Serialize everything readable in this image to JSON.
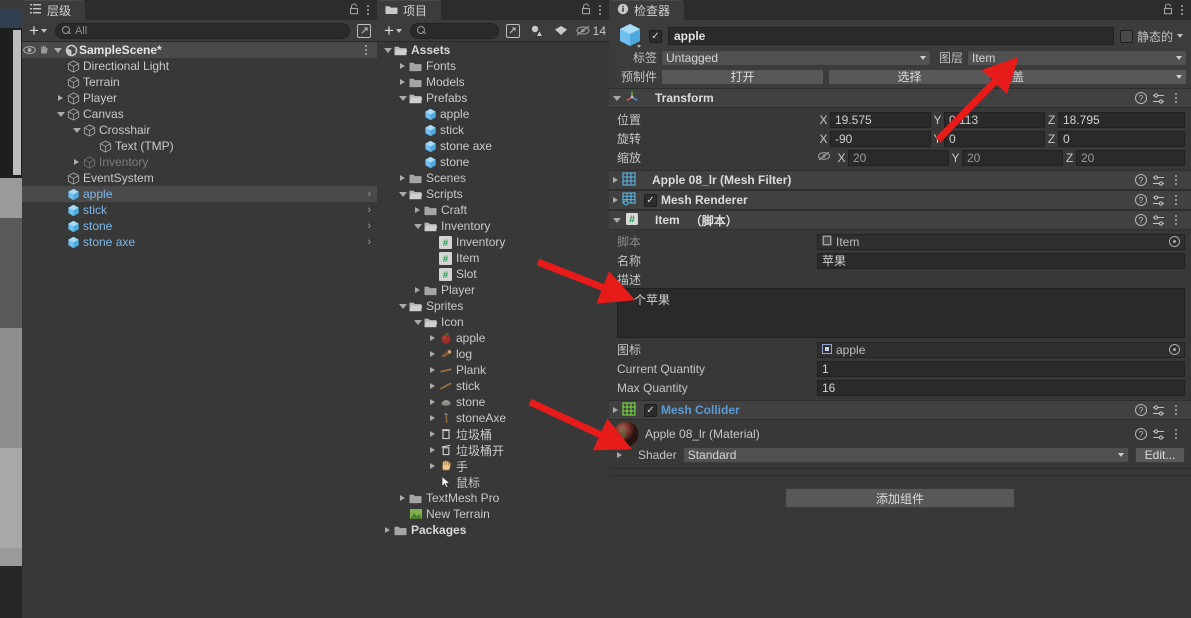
{
  "hierarchy": {
    "tab_label": "层级",
    "tab_icon": "hierarchy-icon",
    "search_placeholder": "All",
    "add_label": "+",
    "items": [
      {
        "label": "SampleScene*",
        "depth": 0,
        "type": "scene",
        "expanded": true
      },
      {
        "label": "Directional Light",
        "depth": 2,
        "type": "gameobject",
        "expanded": null
      },
      {
        "label": "Terrain",
        "depth": 2,
        "type": "gameobject",
        "expanded": null
      },
      {
        "label": "Player",
        "depth": 2,
        "type": "gameobject",
        "expanded": false
      },
      {
        "label": "Canvas",
        "depth": 2,
        "type": "gameobject",
        "expanded": true
      },
      {
        "label": "Crosshair",
        "depth": 3,
        "type": "gameobject",
        "expanded": true
      },
      {
        "label": "Text (TMP)",
        "depth": 4,
        "type": "gameobject",
        "expanded": null
      },
      {
        "label": "Inventory",
        "depth": 3,
        "type": "gameobject-disabled",
        "expanded": false
      },
      {
        "label": "EventSystem",
        "depth": 2,
        "type": "gameobject",
        "expanded": null
      },
      {
        "label": "apple",
        "depth": 2,
        "type": "prefab",
        "expanded": null,
        "selected": true
      },
      {
        "label": "stick",
        "depth": 2,
        "type": "prefab",
        "expanded": null
      },
      {
        "label": "stone",
        "depth": 2,
        "type": "prefab",
        "expanded": null
      },
      {
        "label": "stone axe",
        "depth": 2,
        "type": "prefab",
        "expanded": null
      }
    ]
  },
  "project": {
    "tab_label": "项目",
    "tab_icon": "folder-icon",
    "search_placeholder": "",
    "add_label": "+",
    "hidden_count": "14",
    "items": [
      {
        "label": "Assets",
        "depth": 0,
        "type": "folder-open",
        "expanded": true,
        "bold": true
      },
      {
        "label": "Fonts",
        "depth": 1,
        "type": "folder",
        "expanded": false
      },
      {
        "label": "Models",
        "depth": 1,
        "type": "folder",
        "expanded": false
      },
      {
        "label": "Prefabs",
        "depth": 1,
        "type": "folder-open",
        "expanded": true
      },
      {
        "label": "apple",
        "depth": 2,
        "type": "prefab"
      },
      {
        "label": "stick",
        "depth": 2,
        "type": "prefab"
      },
      {
        "label": "stone axe",
        "depth": 2,
        "type": "prefab"
      },
      {
        "label": "stone",
        "depth": 2,
        "type": "prefab"
      },
      {
        "label": "Scenes",
        "depth": 1,
        "type": "folder",
        "expanded": false
      },
      {
        "label": "Scripts",
        "depth": 1,
        "type": "folder-open",
        "expanded": true
      },
      {
        "label": "Craft",
        "depth": 2,
        "type": "folder",
        "expanded": false
      },
      {
        "label": "Inventory",
        "depth": 2,
        "type": "folder-open",
        "expanded": true
      },
      {
        "label": "Inventory",
        "depth": 3,
        "type": "script"
      },
      {
        "label": "Item",
        "depth": 3,
        "type": "script"
      },
      {
        "label": "Slot",
        "depth": 3,
        "type": "script"
      },
      {
        "label": "Player",
        "depth": 2,
        "type": "folder",
        "expanded": false
      },
      {
        "label": "Sprites",
        "depth": 1,
        "type": "folder-open",
        "expanded": true
      },
      {
        "label": "Icon",
        "depth": 2,
        "type": "folder-open",
        "expanded": true
      },
      {
        "label": "apple",
        "depth": 3,
        "type": "sprite-apple",
        "expanded": false
      },
      {
        "label": "log",
        "depth": 3,
        "type": "sprite-log",
        "expanded": false
      },
      {
        "label": "Plank",
        "depth": 3,
        "type": "sprite-plank",
        "expanded": false
      },
      {
        "label": "stick",
        "depth": 3,
        "type": "sprite-stick",
        "expanded": false
      },
      {
        "label": "stone",
        "depth": 3,
        "type": "sprite-stone",
        "expanded": false
      },
      {
        "label": "stoneAxe",
        "depth": 3,
        "type": "sprite-stoneaxe",
        "expanded": false
      },
      {
        "label": "垃圾桶",
        "depth": 3,
        "type": "sprite-bin",
        "expanded": false
      },
      {
        "label": "垃圾桶开",
        "depth": 3,
        "type": "sprite-binopen",
        "expanded": false
      },
      {
        "label": "手",
        "depth": 3,
        "type": "sprite-hand",
        "expanded": false
      },
      {
        "label": "鼠标",
        "depth": 3,
        "type": "sprite-cursor"
      },
      {
        "label": "TextMesh Pro",
        "depth": 1,
        "type": "folder",
        "expanded": false
      },
      {
        "label": "New Terrain",
        "depth": 1,
        "type": "terrain"
      },
      {
        "label": "Packages",
        "depth": 0,
        "type": "folder",
        "expanded": false,
        "bold": true
      }
    ]
  },
  "inspector": {
    "tab_label": "检查器",
    "tab_icon": "info-icon",
    "object_name": "apple",
    "object_enabled": true,
    "static_label": "静态的",
    "static_checked": false,
    "tag_label": "标签",
    "tag_value": "Untagged",
    "layer_label": "图层",
    "layer_value": "Item",
    "prefab_label": "预制件",
    "prefab_open": "打开",
    "prefab_select": "选择",
    "prefab_overrides": "覆盖",
    "transform": {
      "title": "Transform",
      "position_label": "位置",
      "rotation_label": "旋转",
      "scale_label": "缩放",
      "axes": [
        "X",
        "Y",
        "Z"
      ],
      "position": [
        "19.575",
        "0.113",
        "18.795"
      ],
      "rotation": [
        "-90",
        "0",
        "0"
      ],
      "scale": [
        "20",
        "20",
        "20"
      ]
    },
    "mesh_filter": {
      "title": "Apple 08_lr (Mesh Filter)",
      "expanded": false
    },
    "mesh_renderer": {
      "title": "Mesh Renderer",
      "expanded": false,
      "enabled": true
    },
    "item_script": {
      "title": "Item",
      "suffix": "（脚本）",
      "expanded": true,
      "script_label": "脚本",
      "script_value": "Item",
      "name_label": "名称",
      "name_value": "苹果",
      "desc_label": "描述",
      "desc_value": "一个苹果",
      "icon_label": "图标",
      "icon_value": "apple",
      "current_quantity_label": "Current Quantity",
      "current_quantity_value": "1",
      "max_quantity_label": "Max Quantity",
      "max_quantity_value": "16"
    },
    "mesh_collider": {
      "title": "Mesh Collider",
      "expanded": false,
      "enabled": true
    },
    "material": {
      "title": "Apple 08_lr (Material)",
      "shader_label": "Shader",
      "shader_value": "Standard",
      "edit_label": "Edit..."
    },
    "add_component_label": "添加组件"
  },
  "colors": {
    "panel_bg": "#383838",
    "header_bg": "#3c3c3c",
    "component_header": "#414141",
    "field_bg": "#2a2a2a",
    "prefab_blue": "#7fb7e8",
    "component_blue": "#5b9bd5",
    "accent_red": "#e81b1b",
    "selected_row": "#4a4a4a",
    "script_green": "#1c9e4a"
  },
  "annotations": [
    {
      "name": "arrow-to-layer-field",
      "points_to": "layer_value"
    },
    {
      "name": "arrow-to-name-field",
      "points_to": "item_name_field"
    },
    {
      "name": "arrow-to-mesh-collider",
      "points_to": "mesh_collider_header"
    }
  ]
}
